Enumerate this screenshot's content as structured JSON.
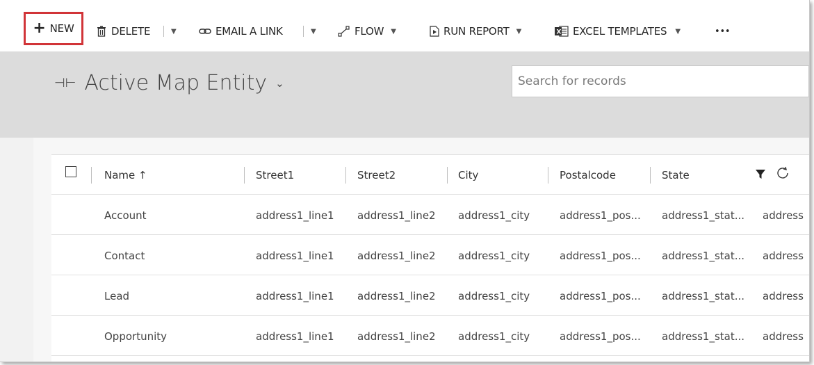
{
  "toolbar": {
    "new_label": "NEW",
    "delete_label": "DELETE",
    "email_label": "EMAIL A LINK",
    "flow_label": "FLOW",
    "run_report_label": "RUN REPORT",
    "excel_label": "EXCEL TEMPLATES",
    "more_label": "•••"
  },
  "header": {
    "title": "Active Map Entity",
    "search_placeholder": "Search for records"
  },
  "table": {
    "columns": [
      "Name ↑",
      "Street1",
      "Street2",
      "City",
      "Postalcode",
      "State"
    ],
    "rows": [
      {
        "name": "Account",
        "street1": "address1_line1",
        "street2": "address1_line2",
        "city": "address1_city",
        "postal": "address1_pos...",
        "state": "address1_stat...",
        "extra": "address"
      },
      {
        "name": "Contact",
        "street1": "address1_line1",
        "street2": "address1_line2",
        "city": "address1_city",
        "postal": "address1_pos...",
        "state": "address1_stat...",
        "extra": "address"
      },
      {
        "name": "Lead",
        "street1": "address1_line1",
        "street2": "address1_line2",
        "city": "address1_city",
        "postal": "address1_pos...",
        "state": "address1_stat...",
        "extra": "address"
      },
      {
        "name": "Opportunity",
        "street1": "address1_line1",
        "street2": "address1_line2",
        "city": "address1_city",
        "postal": "address1_pos...",
        "state": "address1_stat...",
        "extra": "address"
      }
    ]
  },
  "colors": {
    "highlight": "#d13438",
    "header_bg": "#dcdcdc"
  }
}
